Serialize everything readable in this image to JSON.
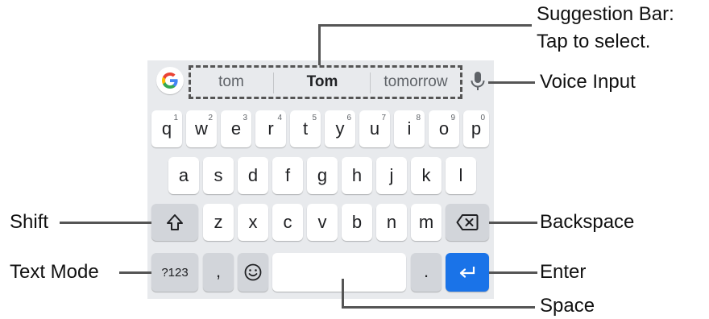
{
  "callouts": {
    "suggestion_bar_1": "Suggestion Bar:",
    "suggestion_bar_2": "Tap to select.",
    "voice_input": "Voice Input",
    "shift": "Shift",
    "backspace": "Backspace",
    "text_mode": "Text Mode",
    "enter": "Enter",
    "space": "Space"
  },
  "suggestions": [
    "tom",
    "Tom",
    "tomorrow"
  ],
  "rows": {
    "row1": [
      {
        "key": "q",
        "sup": "1"
      },
      {
        "key": "w",
        "sup": "2"
      },
      {
        "key": "e",
        "sup": "3"
      },
      {
        "key": "r",
        "sup": "4"
      },
      {
        "key": "t",
        "sup": "5"
      },
      {
        "key": "y",
        "sup": "6"
      },
      {
        "key": "u",
        "sup": "7"
      },
      {
        "key": "i",
        "sup": "8"
      },
      {
        "key": "o",
        "sup": "9"
      },
      {
        "key": "p",
        "sup": "0"
      }
    ],
    "row2": [
      "a",
      "s",
      "d",
      "f",
      "g",
      "h",
      "j",
      "k",
      "l"
    ],
    "row3": [
      "z",
      "x",
      "c",
      "v",
      "b",
      "n",
      "m"
    ]
  },
  "bottom_row": {
    "mode": "?123",
    "comma": ",",
    "period": "."
  },
  "icons": {
    "google": "google-g-icon",
    "mic": "microphone-icon",
    "shift": "shift-arrow-icon",
    "backspace": "backspace-icon",
    "emoji": "smiley-icon",
    "enter": "enter-arrow-icon"
  },
  "colors": {
    "keyboard_bg": "#e8eaed",
    "key_bg": "#ffffff",
    "function_key_bg": "#d2d5da",
    "enter_bg": "#1a73e8"
  }
}
